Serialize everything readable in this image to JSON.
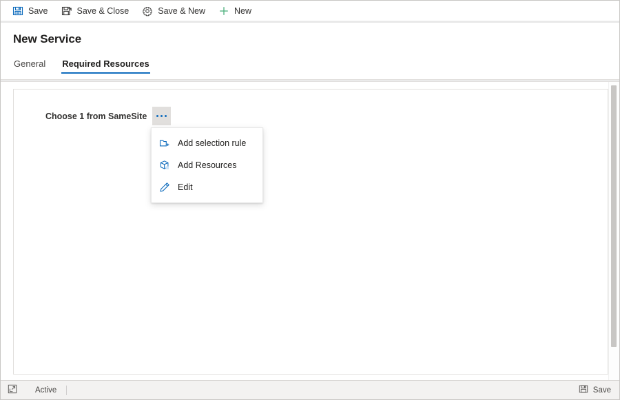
{
  "window": {
    "title": "New Service"
  },
  "command_bar": {
    "buttons": [
      {
        "label": "Save",
        "icon": "save-floppy-icon"
      },
      {
        "label": "Save & Close",
        "icon": "save-and-close-icon"
      },
      {
        "label": "Save & New",
        "icon": "save-and-new-icon"
      },
      {
        "label": "New",
        "icon": "plus-icon"
      }
    ]
  },
  "form": {
    "title": "New Service",
    "tabs": [
      {
        "label": "General",
        "active": false
      },
      {
        "label": "Required Resources",
        "active": true
      }
    ],
    "accent_color": "#0f6cbd"
  },
  "resources": {
    "requirement_label": "Choose 1 from SameSite",
    "ellipsis_label": "...",
    "ellipsis_icon": "ellipsis-icon"
  },
  "context_menu": {
    "items": [
      {
        "label": "Add selection rule",
        "icon": "folder-add-icon"
      },
      {
        "label": "Add Resources",
        "icon": "box-3d-icon"
      },
      {
        "label": "Edit",
        "icon": "pencil-icon"
      }
    ]
  },
  "status_bar": {
    "popout_icon": "popout-expand-icon",
    "state": "Active",
    "save_label": "Save",
    "save_icon": "save-floppy-icon"
  }
}
